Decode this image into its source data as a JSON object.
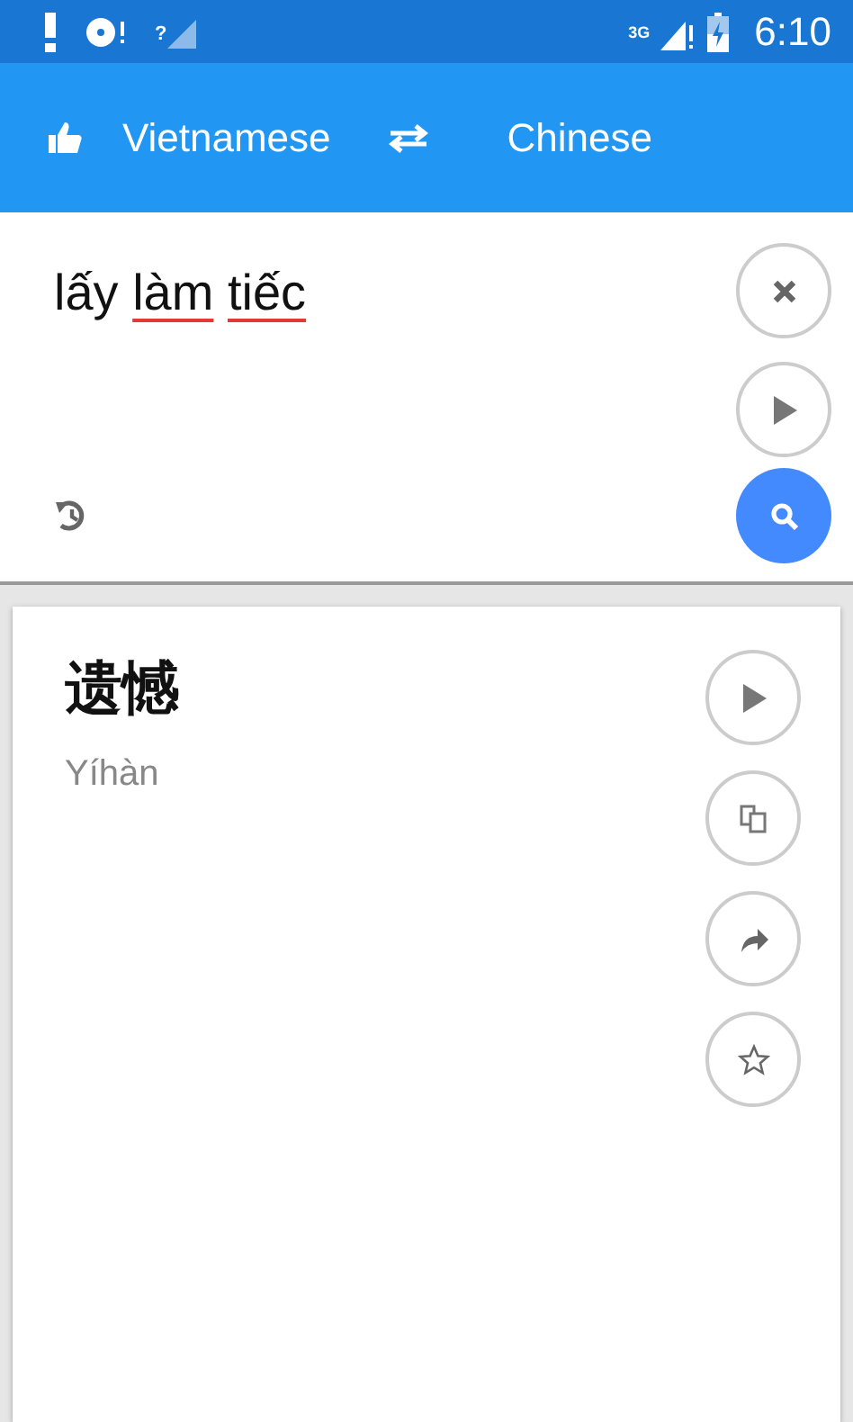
{
  "status_bar": {
    "signal_mark": "?",
    "network_type": "3G",
    "time": "6:10"
  },
  "toolbar": {
    "source_language": "Vietnamese",
    "target_language": "Chinese"
  },
  "input": {
    "words": [
      {
        "text": "lấy",
        "misspelled": false
      },
      {
        "text": "làm",
        "misspelled": true
      },
      {
        "text": "tiếc",
        "misspelled": true
      }
    ]
  },
  "result": {
    "translation": "遗憾",
    "pinyin": "Yíhàn"
  }
}
